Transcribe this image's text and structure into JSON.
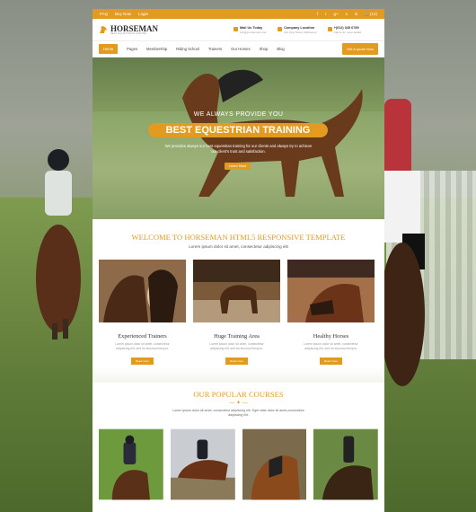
{
  "topbar": {
    "links": [
      "FAQ",
      "Buy Now",
      "Login"
    ],
    "social_icons": [
      "facebook-icon",
      "twitter-icon",
      "google-plus-icon",
      "skype-icon",
      "linkedin-icon"
    ],
    "cart": "(12)"
  },
  "header": {
    "brand": "HORSEMAN",
    "tagline": "BEST EQUESTRIAN CENTRE",
    "contacts": [
      {
        "title": "Mail Us Today",
        "sub": "info@yourdomain.com",
        "icon": "mail-icon"
      },
      {
        "title": "Company Location",
        "sub": "121 King Street, Melbourne",
        "icon": "location-icon"
      },
      {
        "title": "+(012) 345 6789",
        "sub": "Call us for more details",
        "icon": "phone-icon"
      }
    ]
  },
  "nav": {
    "items": [
      "Home",
      "Pages",
      "Membership",
      "Riding School",
      "Trainers",
      "Our Horses",
      "Shop",
      "Blog"
    ],
    "quote_button": "Get A quote Now"
  },
  "hero": {
    "small": "WE ALWAYS PROVIDE YOU",
    "big": "BEST EQUESTRIAN TRAINING",
    "desc": "We provides always our best equestrian training for our clients and always try to achieve our client's trust and satisfaction.",
    "button": "Learn More"
  },
  "welcome": {
    "title": "WELCOME TO HORSEMAN HTML5 RESPONSIVE TEMPLATE",
    "subtitle": "Lorem ipsum dolor sit amet, consectetur adipiscing elit"
  },
  "features": [
    {
      "title": "Experienced Trainers",
      "text": "Lorem ipsum dolor sit amet, consectetur adipiscing elit, sed do eiusmod tempor.",
      "button": "Read more"
    },
    {
      "title": "Huge Training Area",
      "text": "Lorem ipsum dolor sit amet, consectetur adipiscing elit, sed do eiusmod tempor.",
      "button": "Read more"
    },
    {
      "title": "Healthy Horses",
      "text": "Lorem ipsum dolor sit amet, consectetur adipiscing elit, sed do eiusmod tempor.",
      "button": "Read more"
    }
  ],
  "courses": {
    "title": "OUR POPULAR COURSES",
    "subtitle": "Lorem ipsum dolor sit amet, consectetur adipiscing elit. Eget vitae dolor sit amet,consectetur adipiscing elit."
  },
  "colors": {
    "accent": "#e29a1f"
  }
}
